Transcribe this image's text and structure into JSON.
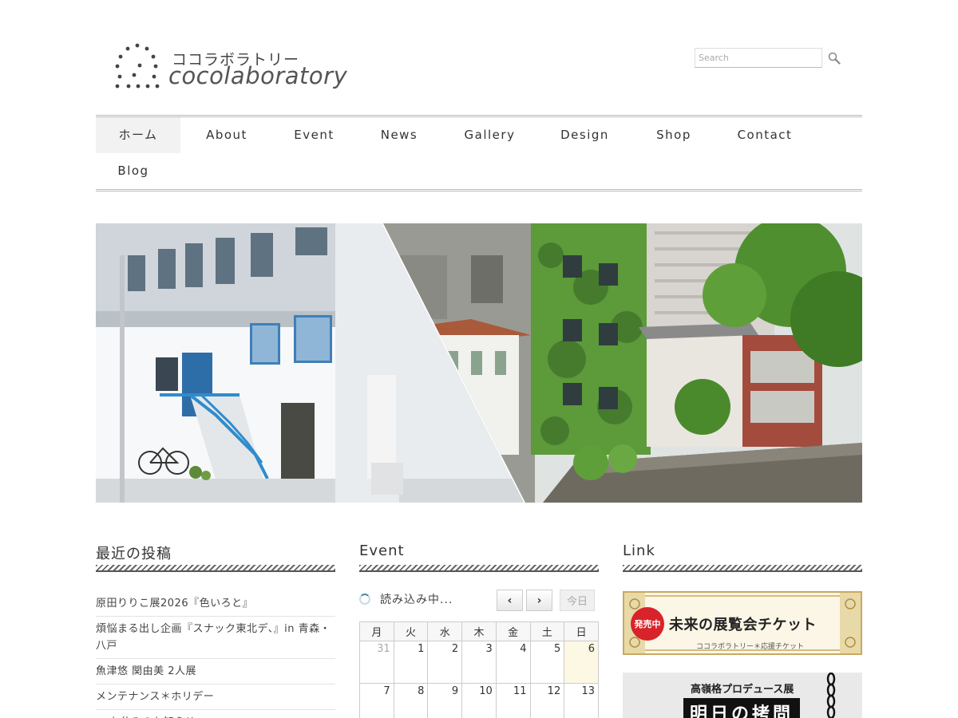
{
  "header": {
    "logo_kana": "ココラボラトリー",
    "logo_en": "cocolaboratory",
    "search_placeholder": "Search"
  },
  "nav": {
    "items": [
      {
        "label": "ホーム"
      },
      {
        "label": "About"
      },
      {
        "label": "Event"
      },
      {
        "label": "News"
      },
      {
        "label": "Gallery"
      },
      {
        "label": "Design"
      },
      {
        "label": "Shop"
      },
      {
        "label": "Contact"
      },
      {
        "label": "Blog"
      }
    ]
  },
  "widgets": {
    "recent_title": "最近の投稿",
    "event_title": "Event",
    "link_title": "Link",
    "recent_posts": [
      "原田りりこ展2026『色いろと』",
      "煩悩まる出し企画『スナック東北デ、』in 青森・八戸",
      "魚津悠 関由美 2人展",
      "メンテナンス＊ホリデー",
      "■ お休みのお知らせ ■"
    ]
  },
  "calendar": {
    "loading": "読み込み中...",
    "prev": "‹",
    "next": "›",
    "today": "今日",
    "weekdays": [
      "月",
      "火",
      "水",
      "木",
      "金",
      "土",
      "日"
    ],
    "row1": [
      "31",
      "1",
      "2",
      "3",
      "4",
      "5",
      "6"
    ],
    "row2": [
      "7",
      "8",
      "9",
      "10",
      "11",
      "12",
      "13"
    ]
  },
  "links": {
    "banner1_badge": "発売中",
    "banner1_title": "未来の展覧会チケット",
    "banner1_sub": "ココラボラトリー＊応援チケット",
    "banner2_title": "高嶺格プロデュース展",
    "banner2_main": "明日の拷問"
  },
  "colors": {
    "badge_red": "#d8232a",
    "banner_gold": "#c9a860",
    "ivy_green": "#5c9a3a"
  }
}
